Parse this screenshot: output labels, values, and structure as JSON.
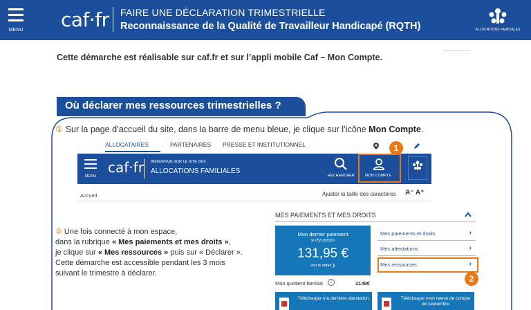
{
  "header": {
    "menu_label": "MENU",
    "logo_text": "caf·fr",
    "title_line1": "FAIRE UNE DÉCLARATION TRIMESTRIELLE",
    "title_line2": "Reconnaissance de la Qualité de Travailleur Handicapé (RQTH)",
    "partner_logo": "ALLOCATIONS FAMILIALES",
    "colors": {
      "brand_blue": "#1b4f9c",
      "accent_orange": "#e97816"
    }
  },
  "intro_text": "Cette démarche est réalisable sur caf.fr et sur l’appli mobile Caf – Mon Compte.",
  "section": {
    "title": "Où déclarer mes ressources trimestrielles ?"
  },
  "step1": {
    "number": "①",
    "text_before": " Sur la page d’accueil du site, dans la barre de menu bleue, je clique sur l’icône ",
    "text_bold": "Mon Compte",
    "text_after": "."
  },
  "screenshot": {
    "nav_links": [
      "ALLOCATAIRES",
      "PARTENAIRES",
      "PRESSE ET INSTITUTIONNEL"
    ],
    "menu_label": "MENU",
    "logo_text": "caf·fr",
    "welcome": "BIENVENUE SUR LE SITE DES",
    "site_name": "ALLOCATIONS FAMILIALES",
    "search_label": "RECHERCHER",
    "account_label": "MON COMPTE",
    "badge_1": "1",
    "badge_2": "2",
    "breadcrumb": "Accueil",
    "text_size_label": "Ajuster la taille des caractères",
    "text_size_buttons": "A⁻ A⁺",
    "payments_title": "MES PAIEMENTS ET MES DROITS",
    "last_payment_label": "Mon dernier paiement",
    "last_payment_date": "le 05/10/2020",
    "last_payment_amount": "131,95 €",
    "detail_link": "Voir le détail ❯",
    "side_links": [
      "Mes paiements et droits",
      "Mes attestations",
      "Mes ressources"
    ],
    "quotient_label": "Mon quotient familial",
    "quotient_value": "2149€",
    "download_1": "Télécharger ma dernière attestation",
    "download_2": "Télécharger mon relevé de compte de septembre"
  },
  "step2": {
    "number": "②",
    "line1": " Une fois connecté à mon espace,",
    "line2_before": "dans la rubrique ",
    "line2_bold": "« Mes paiements et mes droits »",
    "line2_after": ",",
    "line3_before": "je clique sur ",
    "line3_bold": "« Mes ressources »",
    "line3_after": " puis sur « Déclarer ».",
    "line4": "Cette démarche est accessible pendant les 3 mois",
    "line5": "suivant le trimestre à déclarer."
  }
}
